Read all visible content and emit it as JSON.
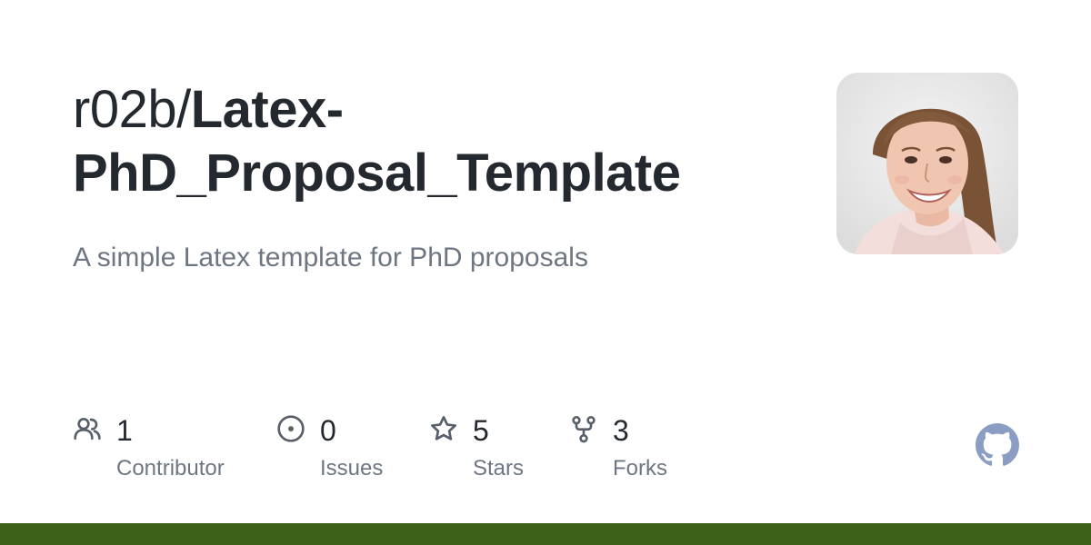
{
  "repo": {
    "owner_prefix": "r02b/",
    "name": "Latex-PhD_Proposal_Template",
    "description": "A simple Latex template for PhD proposals"
  },
  "stats": {
    "contributors": {
      "value": "1",
      "label": "Contributor",
      "icon": "people-icon"
    },
    "issues": {
      "value": "0",
      "label": "Issues",
      "icon": "issue-opened-icon"
    },
    "stars": {
      "value": "5",
      "label": "Stars",
      "icon": "star-icon"
    },
    "forks": {
      "value": "3",
      "label": "Forks",
      "icon": "repo-forked-icon"
    }
  },
  "colors": {
    "title": "#24292f",
    "muted": "#6e7681",
    "icon": "#57606a",
    "github_logo": "#8b9dc3",
    "accent_bar": "#3e6119"
  },
  "avatar": {
    "icon": "avatar-photo"
  },
  "logo": {
    "icon": "github-mark-icon"
  }
}
